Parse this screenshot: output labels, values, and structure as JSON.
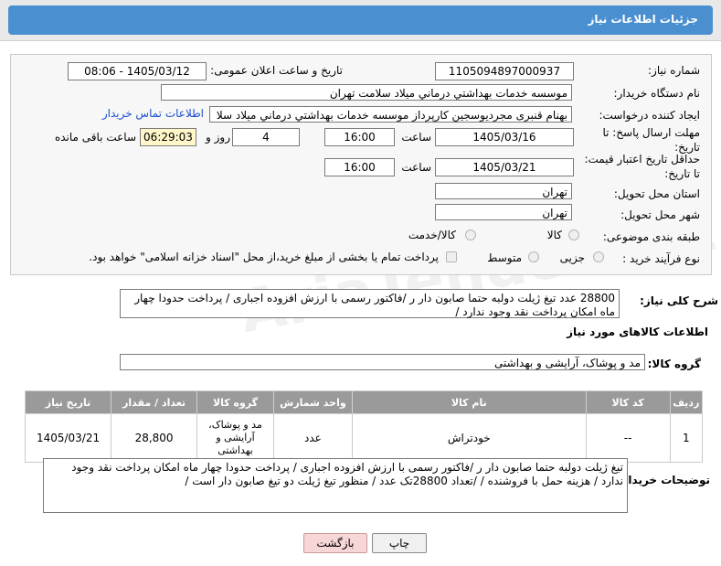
{
  "header": {
    "title": "جزئیات اطلاعات نیاز"
  },
  "form": {
    "need_number_label": "شماره نیاز:",
    "need_number": "1105094897000937",
    "announce_label": "تاریخ و ساعت اعلان عمومی:",
    "announce_value": "1405/03/12 - 08:06",
    "buyer_org_label": "نام دستگاه خریدار:",
    "buyer_org": "موسسه خدمات بهداشتي درماني ميلاد سلامت تهران",
    "requester_label": "ایجاد کننده درخواست:",
    "requester": "بهنام قنبری مجردیوسجین کارپرداز موسسه خدمات بهداشتي درماني ميلاد سلا",
    "contact_link": "اطلاعات تماس خریدار",
    "deadline_label": "مهلت ارسال پاسخ: تا تاریخ:",
    "deadline_date": "1405/03/16",
    "time_label": "ساعت",
    "deadline_time": "16:00",
    "days_value": "4",
    "days_label": "روز و",
    "remaining_time": "06:29:03",
    "remaining_label": "ساعت باقی مانده",
    "validity_label": "حداقل تاریخ اعتبار قیمت: تا تاریخ:",
    "validity_date": "1405/03/21",
    "validity_time": "16:00",
    "province_label": "استان محل تحویل:",
    "province": "تهران",
    "city_label": "شهر محل تحویل:",
    "city": "تهران",
    "category_label": "طبقه بندی موضوعی:",
    "category_options": [
      "کالا",
      "کالا/خدمت"
    ],
    "purchase_type_label": "نوع فرآیند خرید :",
    "purchase_options": [
      "جزیی",
      "متوسط"
    ],
    "payment_note": "پرداخت تمام یا بخشی از مبلغ خرید،از محل \"اسناد خزانه اسلامی\" خواهد بود."
  },
  "summary": {
    "label": "شرح کلی نیاز:",
    "text": "28800 عدد تیغ ژیلت دولبه حتما صابون دار ر /فاکتور رسمی با ارزش افزوده  اجباری / پرداخت حدودا  چهار ماه امکان پرداخت نقد وجود ندارد /"
  },
  "goods": {
    "section_title": "اطلاعات کالاهای مورد نیاز",
    "group_label": "گروه کالا:",
    "group_value": "مد و پوشاک، آرایشی و بهداشتی",
    "columns": [
      "ردیف",
      "کد کالا",
      "نام کالا",
      "واحد شمارش",
      "گروه کالا",
      "تعداد / مقدار",
      "تاریخ نیاز"
    ],
    "rows": [
      {
        "row": "1",
        "code": "--",
        "name": "خودتراش",
        "unit": "عدد",
        "group": "مد و پوشاک، آرایشی و بهداشتی",
        "qty": "28,800",
        "date": "1405/03/21"
      }
    ]
  },
  "buyer_notes": {
    "label": "توضیحات خریدار:",
    "text": "تیغ ژیلت دولبه حتما صابون دار ر /فاکتور رسمی با ارزش افزوده  اجباری / پرداخت حدودا  چهار ماه امکان پرداخت نقد وجود ندارد / هزینه حمل با فروشنده / /تعداد 28800تک عدد / منظور تیغ ژیلت  دو تیغ صابون دار است  /"
  },
  "buttons": {
    "print": "چاپ",
    "back": "بازگشت"
  },
  "watermark": "AriaTender.net"
}
